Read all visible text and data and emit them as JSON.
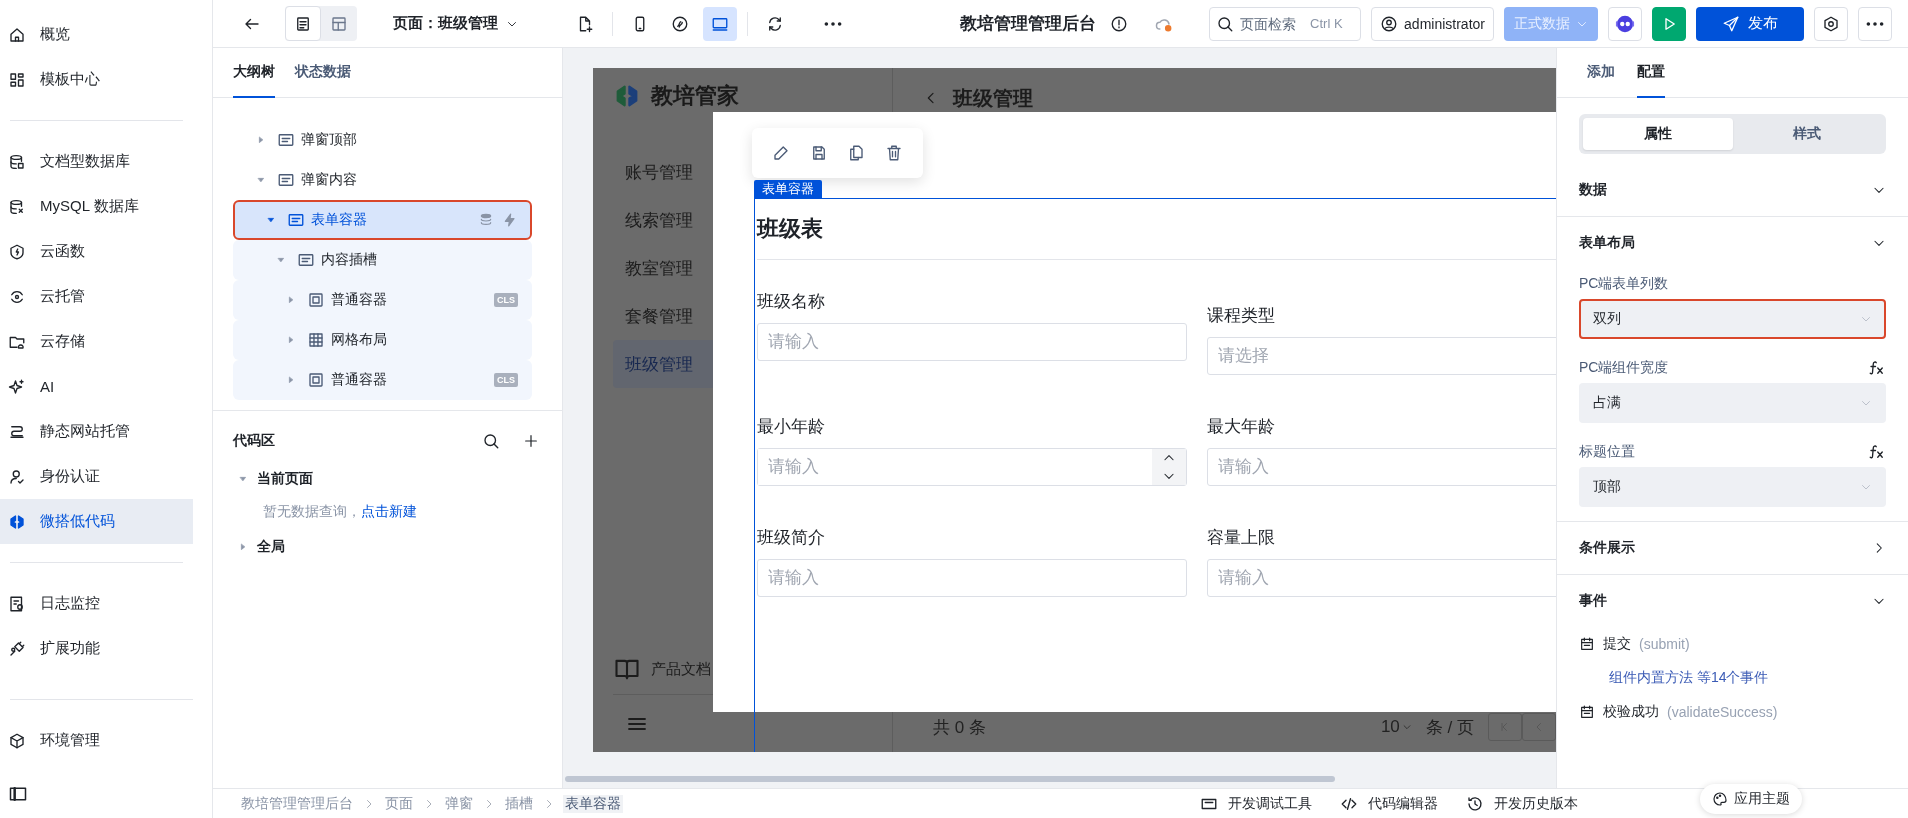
{
  "nav": {
    "groups": [
      [
        {
          "label": "概览",
          "selected": false
        },
        {
          "label": "模板中心",
          "selected": false
        }
      ],
      [
        {
          "label": "文档型数据库",
          "selected": false
        },
        {
          "label": "MySQL 数据库",
          "selected": false
        },
        {
          "label": "云函数",
          "selected": false
        },
        {
          "label": "云托管",
          "selected": false
        },
        {
          "label": "云存储",
          "selected": false
        },
        {
          "label": "AI",
          "selected": false
        },
        {
          "label": "静态网站托管",
          "selected": false
        },
        {
          "label": "身份认证",
          "selected": false
        },
        {
          "label": "微搭低代码",
          "selected": true
        }
      ],
      [
        {
          "label": "日志监控",
          "selected": false
        },
        {
          "label": "扩展功能",
          "selected": false
        }
      ],
      [
        {
          "label": "环境管理",
          "selected": false
        }
      ]
    ]
  },
  "toolbar": {
    "view_modes": [
      {
        "selected": true
      },
      {
        "selected": false
      }
    ],
    "page_selector": "页面：班级管理",
    "devices": [
      {
        "selected": false
      },
      {
        "selected": false
      },
      {
        "selected": true
      }
    ],
    "app_title": "教培管理管理后台",
    "search": {
      "placeholder": "页面检索",
      "shortcut": "Ctrl K"
    },
    "user": "administrator",
    "data_source": {
      "label": "正式数据",
      "disabled": true
    },
    "publish": "发布"
  },
  "outline": {
    "tabs": [
      {
        "label": "大纲树",
        "selected": true
      },
      {
        "label": "状态数据",
        "selected": false
      }
    ],
    "tree": [
      {
        "label": "弹窗顶部",
        "kind": "block",
        "expanded": false,
        "selected": false,
        "annotated": false
      },
      {
        "label": "弹窗内容",
        "kind": "block",
        "expanded": true,
        "selected": false,
        "annotated": false,
        "children": [
          {
            "label": "表单容器",
            "kind": "block",
            "expanded": true,
            "selected": true,
            "annotated": true,
            "children": [
              {
                "label": "内容插槽",
                "kind": "block",
                "expanded": true,
                "selected": false,
                "annotated": false,
                "children": [
                  {
                    "label": "普通容器",
                    "kind": "container",
                    "expanded": false,
                    "selected": false,
                    "annotated": false,
                    "badge": "CLS"
                  },
                  {
                    "label": "网格布局",
                    "kind": "grid",
                    "expanded": false,
                    "selected": false,
                    "annotated": false
                  },
                  {
                    "label": "普通容器",
                    "kind": "container",
                    "expanded": false,
                    "selected": false,
                    "annotated": false,
                    "badge": "CLS"
                  }
                ]
              }
            ]
          }
        ]
      }
    ]
  },
  "code_area": {
    "title": "代码区",
    "sections": [
      {
        "label": "当前页面",
        "expanded": true,
        "empty_text": "暂无数据查询，",
        "empty_link": "点击新建"
      },
      {
        "label": "全局",
        "expanded": false
      }
    ]
  },
  "preview": {
    "app_name": "教培管家",
    "menu": [
      {
        "label": "账号管理",
        "selected": false
      },
      {
        "label": "线索管理",
        "selected": false
      },
      {
        "label": "教室管理",
        "selected": false
      },
      {
        "label": "套餐管理",
        "selected": false
      },
      {
        "label": "班级管理",
        "selected": true
      }
    ],
    "docs_link": "产品文档",
    "header_title": "班级管理",
    "footer": {
      "total": "共 0 条",
      "page_size": "10",
      "page_size_unit": "条 / 页"
    },
    "modal": {
      "tag": "表单容器",
      "title": "班级表",
      "fields": [
        {
          "label": "班级名称",
          "placeholder": "请输入",
          "kind": "text"
        },
        {
          "label": "课程类型",
          "placeholder": "请选择",
          "kind": "select"
        },
        {
          "label": "最小年龄",
          "placeholder": "请输入",
          "kind": "number"
        },
        {
          "label": "最大年龄",
          "placeholder": "请输入",
          "kind": "text"
        },
        {
          "label": "班级简介",
          "placeholder": "请输入",
          "kind": "text"
        },
        {
          "label": "容量上限",
          "placeholder": "请输入",
          "kind": "text"
        }
      ]
    }
  },
  "config": {
    "tabs": [
      {
        "label": "添加",
        "selected": false
      },
      {
        "label": "配置",
        "selected": true
      }
    ],
    "segments": [
      {
        "label": "属性",
        "selected": true
      },
      {
        "label": "样式",
        "selected": false
      }
    ],
    "sections": [
      {
        "title": "数据",
        "expanded": true
      },
      {
        "title": "表单布局",
        "expanded": true,
        "props": [
          {
            "label": "PC端表单列数",
            "value": "双列",
            "formula": false,
            "annotated": true
          },
          {
            "label": "PC端组件宽度",
            "value": "占满",
            "formula": true,
            "annotated": false
          },
          {
            "label": "标题位置",
            "value": "顶部",
            "formula": true,
            "annotated": false
          }
        ]
      },
      {
        "title": "条件展示",
        "expanded": false
      },
      {
        "title": "事件",
        "expanded": true,
        "events": [
          {
            "name": "提交",
            "code": "(submit)",
            "more": "组件内置方法 等14个事件"
          },
          {
            "name": "校验成功",
            "code": "(validateSuccess)"
          }
        ]
      }
    ],
    "theme_button": "应用主题"
  },
  "status_bar": {
    "breadcrumb": [
      "教培管理管理后台",
      "页面",
      "弹窗",
      "插槽",
      "表单容器"
    ],
    "tools": [
      "开发调试工具",
      "代码编辑器",
      "开发历史版本"
    ]
  }
}
